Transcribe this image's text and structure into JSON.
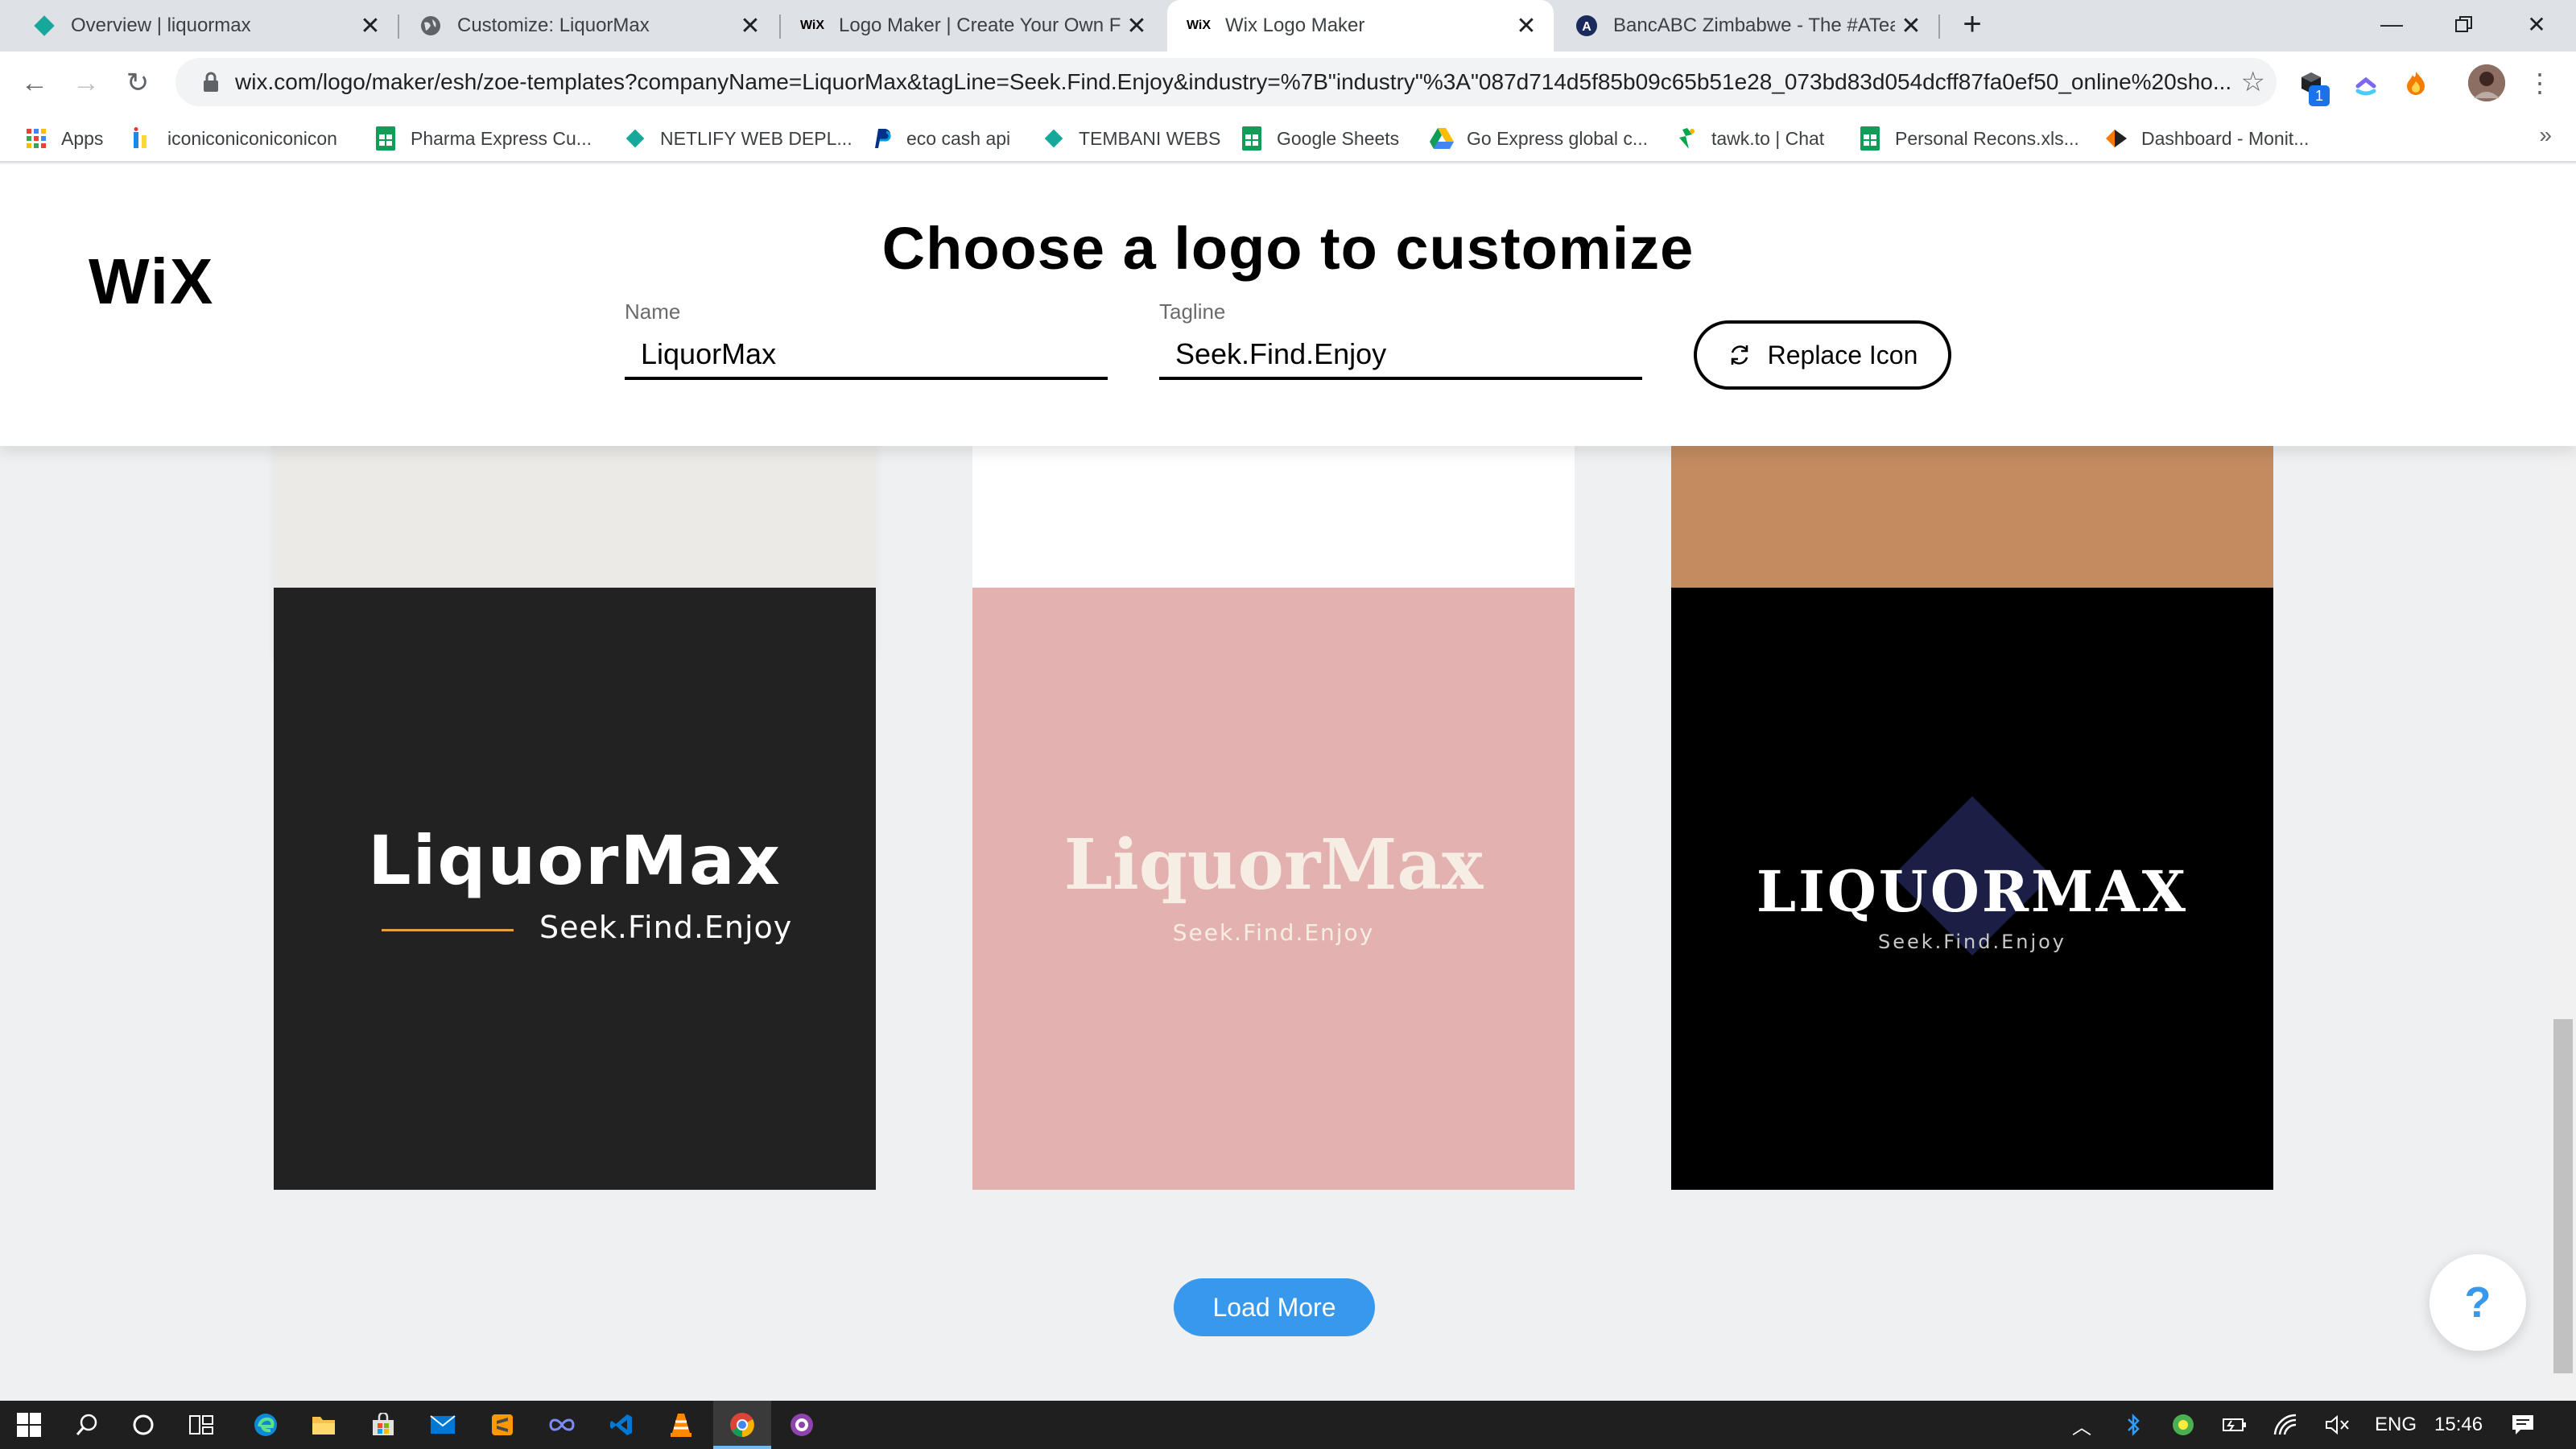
{
  "browser": {
    "tabs": [
      {
        "title": "Overview | liquormax",
        "icon": "wix-diamond-icon",
        "active": false
      },
      {
        "title": "Customize: LiquorMax",
        "icon": "globe-icon",
        "active": false
      },
      {
        "title": "Logo Maker | Create Your Own Free Logo",
        "icon": "wix-favicon",
        "active": false
      },
      {
        "title": "Wix Logo Maker",
        "icon": "wix-favicon",
        "active": true
      },
      {
        "title": "BancABC Zimbabwe - The #ATeam",
        "icon": "bancabc-icon",
        "active": false
      }
    ],
    "new_tab": "+",
    "url": "wix.com/logo/maker/esh/zoe-templates?companyName=LiquorMax&tagLine=Seek.Find.Enjoy&industry=%7B\"industry\"%3A\"087d714d5f85b09c65b51e28_073bd83d054dcff87fa0ef50_online%20sho...",
    "extension_badge": "1",
    "bookmarks": [
      {
        "label": "Apps",
        "icon": "apps-grid-icon"
      },
      {
        "label": "iconiconiconiconicon",
        "icon": "iconicon-icon"
      },
      {
        "label": "Pharma Express Cu...",
        "icon": "sheets-icon"
      },
      {
        "label": "NETLIFY WEB DEPL...",
        "icon": "netlify-icon"
      },
      {
        "label": "eco cash api",
        "icon": "paypal-icon"
      },
      {
        "label": "TEMBANI WEBS",
        "icon": "netlify-icon"
      },
      {
        "label": "Google Sheets",
        "icon": "sheets-icon"
      },
      {
        "label": "Go Express global c...",
        "icon": "drive-icon"
      },
      {
        "label": "tawk.to | Chat",
        "icon": "tawk-icon"
      },
      {
        "label": "Personal Recons.xls...",
        "icon": "sheets-icon"
      },
      {
        "label": "Dashboard - Monit...",
        "icon": "dashboard-icon"
      }
    ]
  },
  "header": {
    "brand": "WiX",
    "title": "Choose a logo to customize",
    "name_label": "Name",
    "name_value": "LiquorMax",
    "tagline_label": "Tagline",
    "tagline_value": "Seek.Find.Enjoy",
    "replace_icon_label": "Replace Icon"
  },
  "logos": [
    {
      "name": "LiquorMax",
      "tagline": "Seek.Find.Enjoy",
      "background": "#222222",
      "name_color": "#ffffff",
      "tagline_color": "#ffffff",
      "accent": "#e0a43a"
    },
    {
      "name": "LiquorMax",
      "tagline": "Seek.Find.Enjoy",
      "background": "#e4b1b1",
      "name_color": "#f6eee4",
      "tagline_color": "#f6eee4"
    },
    {
      "name": "LIQUORMAX",
      "tagline": "Seek.Find.Enjoy",
      "background": "#000000",
      "name_color": "#ffffff",
      "tagline_color": "#c9c9c9",
      "accent": "#1c1f45"
    }
  ],
  "partial_cards": [
    {
      "background": "#eceae6"
    },
    {
      "background": "#ffffff"
    },
    {
      "background": "#c38b60"
    }
  ],
  "load_more_label": "Load More",
  "help_label": "?",
  "taskbar": {
    "language": "ENG",
    "time": "15:46"
  }
}
